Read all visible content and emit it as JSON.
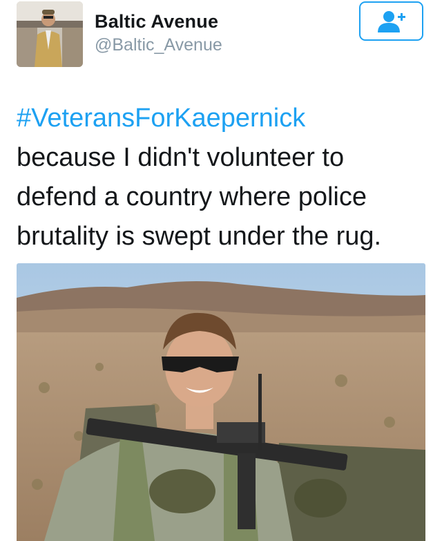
{
  "user": {
    "display_name": "Baltic Avenue",
    "handle": "@Baltic_Avenue"
  },
  "follow_button": {
    "icon": "add-user-icon",
    "color": "#1da1f2"
  },
  "tweet": {
    "hashtag": "#VeteransForKaepernick",
    "lines": [
      "because I didn't volunteer to",
      "defend a country where police",
      "brutality is swept under the rug."
    ]
  },
  "colors": {
    "accent": "#1da1f2",
    "text": "#14171a",
    "secondary": "#8899a6"
  }
}
